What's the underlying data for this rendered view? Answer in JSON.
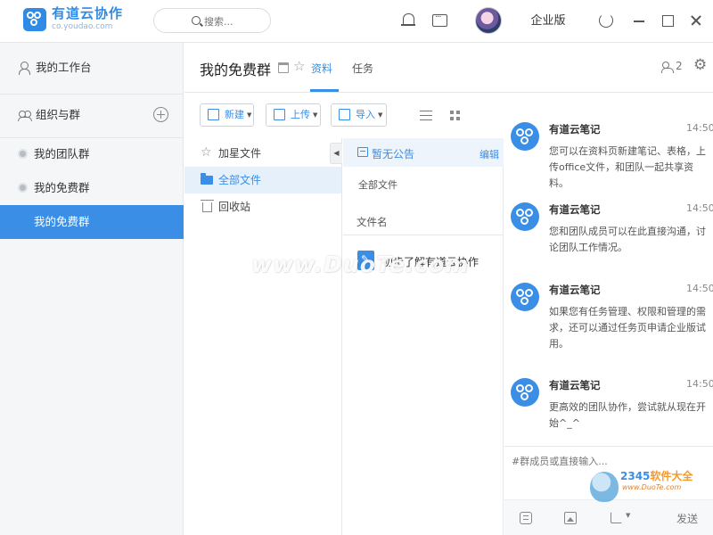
{
  "app": {
    "name": "有道云协作",
    "domain": "co.youdao.com"
  },
  "topbar": {
    "search_placeholder": "搜索...",
    "enterprise_label": "企业版"
  },
  "sidebar": {
    "workspace_label": "我的工作台",
    "org_label": "组织与群",
    "groups": [
      {
        "label": "我的团队群"
      },
      {
        "label": "我的免费群"
      },
      {
        "label": "我的免费群"
      }
    ]
  },
  "group": {
    "title": "我的免费群",
    "tabs": [
      {
        "label": "资料"
      },
      {
        "label": "任务"
      }
    ],
    "member_count": "2"
  },
  "toolbar": {
    "new_label": "新建",
    "upload_label": "上传",
    "import_label": "导入"
  },
  "folders": [
    {
      "label": "加星文件"
    },
    {
      "label": "全部文件"
    },
    {
      "label": "回收站"
    }
  ],
  "files": {
    "notice_text": "暂无公告",
    "notice_edit": "编辑",
    "breadcrumb": "全部文件",
    "column_header": "文件名",
    "rows": [
      {
        "name": "初步了解有道云协作"
      }
    ]
  },
  "chat": {
    "messages": [
      {
        "sender": "有道云笔记",
        "time": "14:50",
        "text": "您可以在资料页新建笔记、表格，上传office文件，和团队一起共享资料。"
      },
      {
        "sender": "有道云笔记",
        "time": "14:50",
        "text": "您和团队成员可以在此直接沟通，讨论团队工作情况。"
      },
      {
        "sender": "有道云笔记",
        "time": "14:50",
        "text": "如果您有任务管理、权限和管理的需求，还可以通过任务页申请企业版试用。"
      },
      {
        "sender": "有道云笔记",
        "time": "14:50",
        "text": "更高效的团队协作，尝试就从现在开始^_^"
      }
    ],
    "input_placeholder": "#群成员或直接输入...",
    "send_label": "发送"
  },
  "watermarks": {
    "duote": "www.DuoTe.com",
    "brand_2345_prefix": "2345",
    "brand_2345_suffix": "软件大全",
    "site_2345": "www.DuoTe.com"
  },
  "colors": {
    "accent": "#3a8ee6",
    "sidebar_bg": "#f5f6f8",
    "active_folder_bg": "#e6f0fb"
  },
  "icons": {
    "logo": "youdao-collab-logo",
    "bell": "bell-icon",
    "chat": "chat-icon",
    "settings": "gear-icon"
  }
}
